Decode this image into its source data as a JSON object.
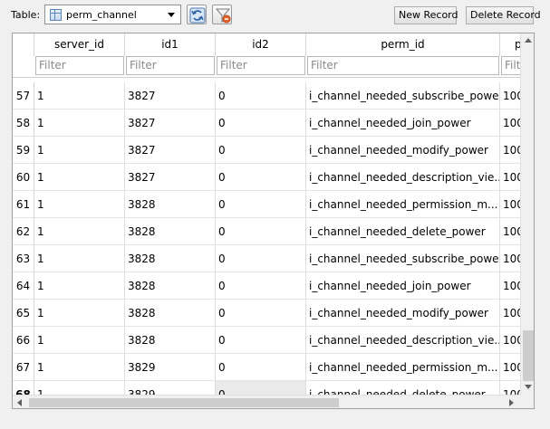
{
  "toolbar": {
    "table_label": "Table:",
    "table_select": "perm_channel",
    "table_icon": "table-icon",
    "refresh_icon": "refresh-icon",
    "clear_filter_icon": "clear-filter-icon",
    "new_record": "New Record",
    "delete_record": "Delete Record"
  },
  "grid": {
    "columns": [
      {
        "label": "server_id",
        "filter": "Filter"
      },
      {
        "label": "id1",
        "filter": "Filter"
      },
      {
        "label": "id2",
        "filter": "Filter"
      },
      {
        "label": "perm_id",
        "filter": "Filter"
      },
      {
        "label": "p",
        "filter": "Filt"
      }
    ],
    "rows": [
      {
        "num": "57",
        "cells": [
          "1",
          "3827",
          "0",
          "i_channel_needed_subscribe_power",
          "100"
        ]
      },
      {
        "num": "58",
        "cells": [
          "1",
          "3827",
          "0",
          "i_channel_needed_join_power",
          "100"
        ]
      },
      {
        "num": "59",
        "cells": [
          "1",
          "3827",
          "0",
          "i_channel_needed_modify_power",
          "100"
        ]
      },
      {
        "num": "60",
        "cells": [
          "1",
          "3827",
          "0",
          "i_channel_needed_description_vie...",
          "100"
        ]
      },
      {
        "num": "61",
        "cells": [
          "1",
          "3828",
          "0",
          "i_channel_needed_permission_m...",
          "100"
        ]
      },
      {
        "num": "62",
        "cells": [
          "1",
          "3828",
          "0",
          "i_channel_needed_delete_power",
          "100"
        ]
      },
      {
        "num": "63",
        "cells": [
          "1",
          "3828",
          "0",
          "i_channel_needed_subscribe_power",
          "100"
        ]
      },
      {
        "num": "64",
        "cells": [
          "1",
          "3828",
          "0",
          "i_channel_needed_join_power",
          "100"
        ]
      },
      {
        "num": "65",
        "cells": [
          "1",
          "3828",
          "0",
          "i_channel_needed_modify_power",
          "100"
        ]
      },
      {
        "num": "66",
        "cells": [
          "1",
          "3828",
          "0",
          "i_channel_needed_description_vie...",
          "100"
        ]
      },
      {
        "num": "67",
        "cells": [
          "1",
          "3829",
          "0",
          "i_channel_needed_permission_m...",
          "100"
        ]
      },
      {
        "num": "68",
        "cells": [
          "1",
          "3829",
          "0",
          "i_channel_needed_delete_power",
          "100"
        ]
      }
    ],
    "current_row": "68",
    "selected_column": "id2"
  }
}
